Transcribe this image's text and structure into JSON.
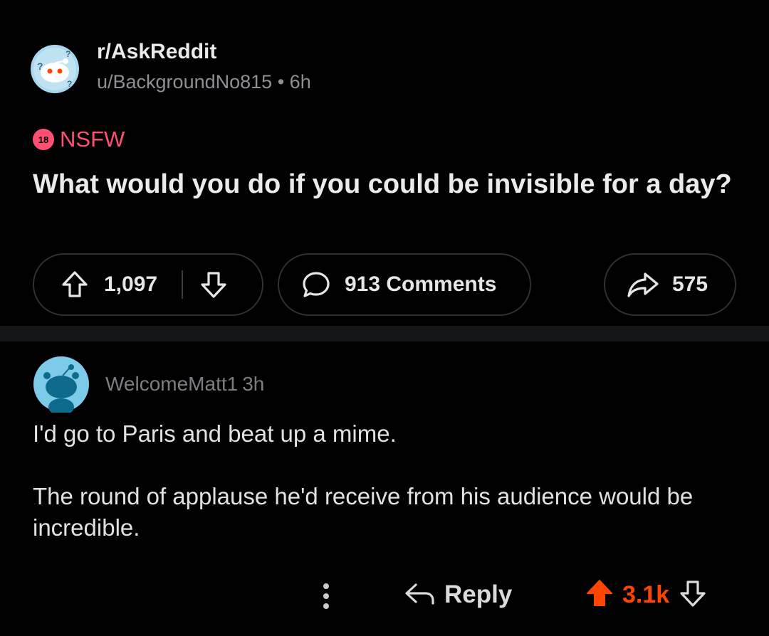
{
  "post": {
    "subreddit": "r/AskReddit",
    "author": "u/BackgroundNo815",
    "separator": "•",
    "age": "6h",
    "nsfw_badge": "18",
    "nsfw_label": "NSFW",
    "title": "What would you do if you could be invisible for a day?",
    "upvotes": "1,097",
    "comments_label": "913 Comments",
    "shares": "575"
  },
  "comment": {
    "author": "WelcomeMatt1",
    "age": "3h",
    "paragraphs": [
      "I'd go to Paris and beat up a mime.",
      "The round of applause he'd receive from his audience would be incredible."
    ],
    "reply_label": "Reply",
    "score": "3.1k"
  },
  "colors": {
    "background": "#000000",
    "nsfw": "#ff4f73",
    "upvoted": "#ff4500",
    "avatar_blue": "#7ecbe9"
  },
  "icons": {
    "subreddit_avatar": "askreddit-icon",
    "upvote": "upvote-arrow-icon",
    "downvote": "downvote-arrow-icon",
    "comments": "speech-bubble-icon",
    "share": "share-arrow-icon",
    "more": "more-vertical-icon",
    "reply": "reply-arrow-icon"
  }
}
